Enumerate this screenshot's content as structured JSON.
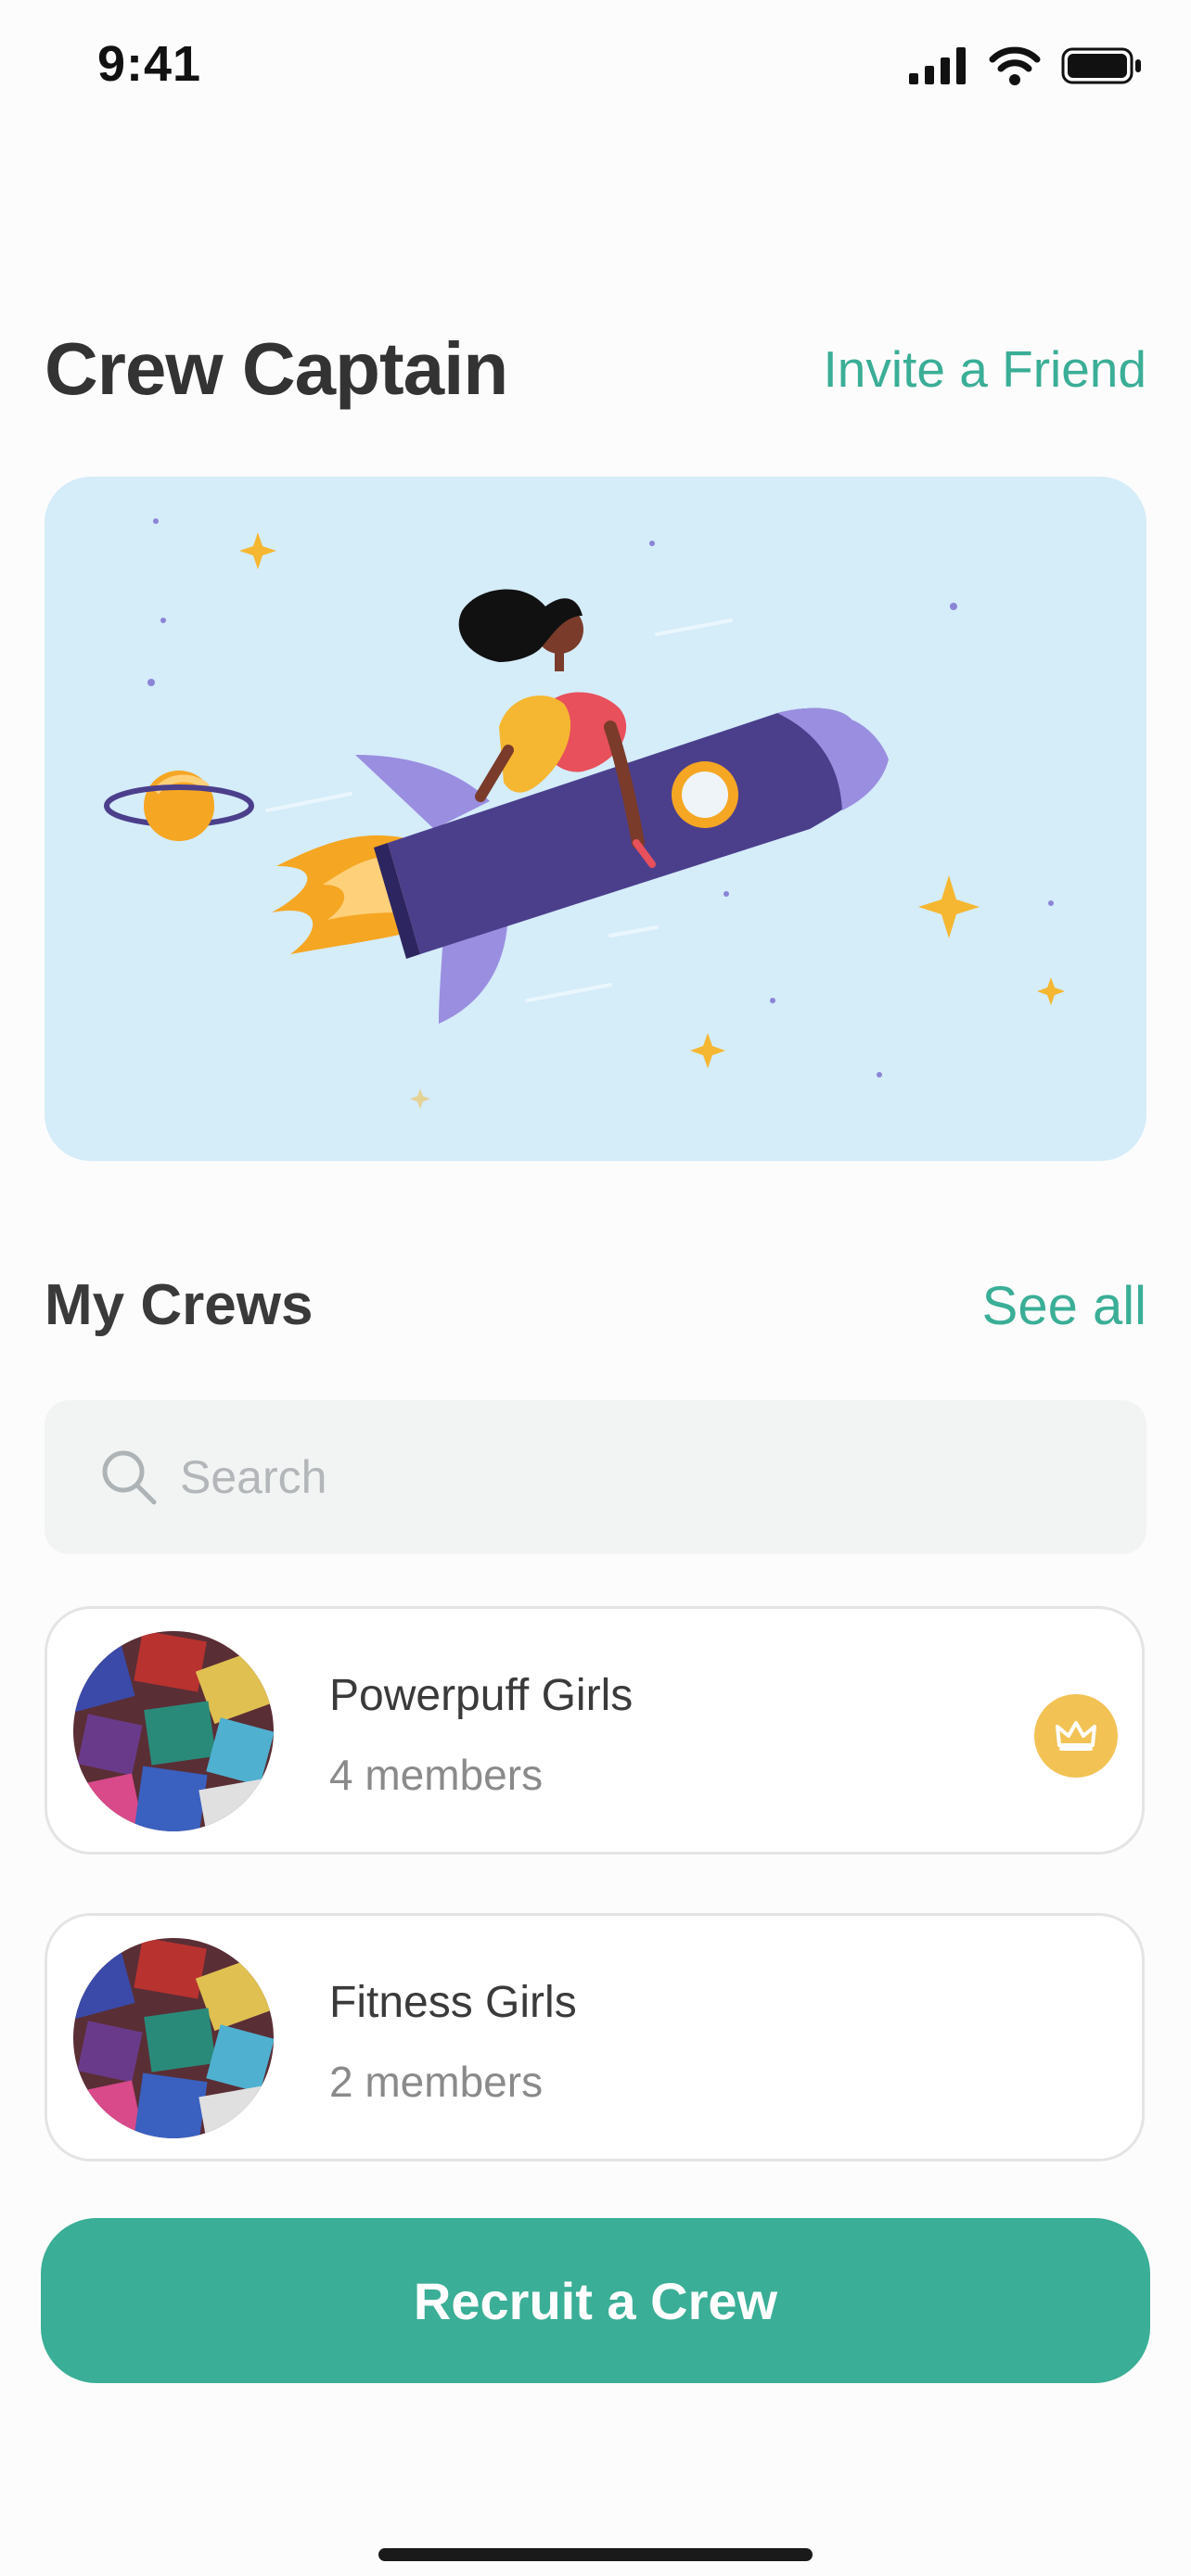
{
  "status_bar": {
    "time": "9:41"
  },
  "header": {
    "title": "Crew Captain",
    "invite_label": "Invite a Friend"
  },
  "crews_section": {
    "title": "My Crews",
    "see_all_label": "See all",
    "search": {
      "placeholder": "Search"
    },
    "crews": [
      {
        "name": "Powerpuff Girls",
        "members": "4 members",
        "captain_badge": true
      },
      {
        "name": "Fitness Girls",
        "members": "2 members",
        "captain_badge": false
      }
    ]
  },
  "primary_action": {
    "label": "Recruit a Crew"
  },
  "icons": [
    "cellular-signal-icon",
    "wifi-icon",
    "battery-icon",
    "search-icon",
    "crown-icon"
  ],
  "colors": {
    "accent": "#3aae96",
    "hero_background": "#d5ecf9",
    "badge": "#f2c255",
    "rocket": "#4b3f8c"
  }
}
